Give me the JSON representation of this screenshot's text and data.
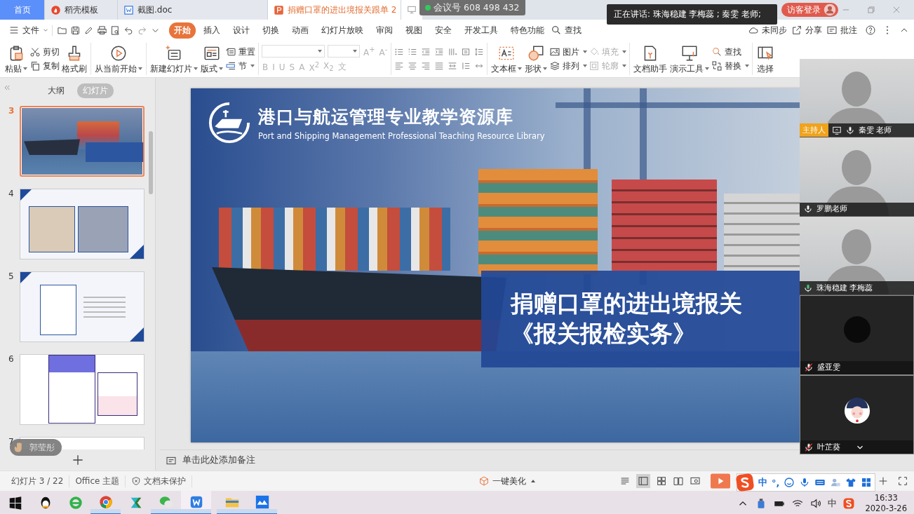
{
  "tabs": [
    {
      "label": "首页",
      "kind": "home",
      "selected": false
    },
    {
      "label": "稻壳模板",
      "kind": "template",
      "selected": false
    },
    {
      "label": "截图.doc",
      "kind": "doc",
      "selected": false
    },
    {
      "label": "捐赠口罩的进出境报关跟单 2",
      "kind": "ppt",
      "selected": true
    }
  ],
  "meeting_id": "会议号 608 498 432",
  "speaking": "正在讲话: 珠海稳建 李梅蕊 ; 秦雯 老师;",
  "guest_login": "访客登录",
  "menu": {
    "file": "文件",
    "tabs": [
      {
        "label": "开始",
        "selected": true
      },
      {
        "label": "插入",
        "selected": false
      },
      {
        "label": "设计",
        "selected": false
      },
      {
        "label": "切换",
        "selected": false
      },
      {
        "label": "动画",
        "selected": false
      },
      {
        "label": "幻灯片放映",
        "selected": false
      },
      {
        "label": "审阅",
        "selected": false
      },
      {
        "label": "视图",
        "selected": false
      },
      {
        "label": "安全",
        "selected": false
      },
      {
        "label": "开发工具",
        "selected": false
      },
      {
        "label": "特色功能",
        "selected": false
      }
    ],
    "search": "查找",
    "actions": [
      "未同步",
      "分享",
      "批注"
    ]
  },
  "ribbon": [
    {
      "items": [
        {
          "kind": "large",
          "label": "粘贴",
          "dropdown": true
        },
        {
          "kind": "pair",
          "items": [
            {
              "label": "剪切",
              "dropdown": false,
              "disabled": false
            },
            {
              "label": "复制",
              "dropdown": false,
              "disabled": false
            }
          ]
        },
        {
          "kind": "large",
          "label": "格式刷",
          "dropdown": false
        }
      ]
    },
    {
      "items": [
        {
          "kind": "large",
          "label": "从当前开始",
          "dropdown": true
        }
      ]
    },
    {
      "items": [
        {
          "kind": "large",
          "label": "新建幻灯片",
          "dropdown": true
        },
        {
          "kind": "large",
          "label": "版式",
          "dropdown": true
        },
        {
          "kind": "pair",
          "items": [
            {
              "label": "重置",
              "dropdown": false,
              "disabled": false
            },
            {
              "label": "节",
              "dropdown": true,
              "disabled": false
            }
          ]
        }
      ]
    },
    {
      "items": [
        {
          "kind": "font",
          "disabled": true,
          "size_glyphs": [
            "A$^{+}$",
            "A$^{-}$"
          ],
          "glyphs": [
            "B",
            "I",
            "U",
            "S",
            "A",
            "X$^{2}$",
            "X$_{2}$",
            "文"
          ]
        }
      ]
    },
    {
      "items": [
        {
          "kind": "paragraph"
        }
      ]
    },
    {
      "items": [
        {
          "kind": "large",
          "label": "文本框",
          "dropdown": true
        },
        {
          "kind": "large",
          "label": "形状",
          "dropdown": true
        },
        {
          "kind": "pair",
          "items": [
            {
              "label": "图片",
              "dropdown": true,
              "disabled": false
            },
            {
              "label": "排列",
              "dropdown": true,
              "disabled": false
            }
          ]
        },
        {
          "kind": "pair",
          "items": [
            {
              "label": "填充",
              "dropdown": true,
              "disabled": true
            },
            {
              "label": "轮廓",
              "dropdown": true,
              "disabled": true
            }
          ]
        }
      ]
    },
    {
      "items": [
        {
          "kind": "large",
          "label": "文档助手",
          "dropdown": false
        },
        {
          "kind": "large",
          "label": "演示工具",
          "dropdown": true
        },
        {
          "kind": "pair",
          "items": [
            {
              "label": "查找",
              "dropdown": false,
              "disabled": false
            },
            {
              "label": "替换",
              "dropdown": true,
              "disabled": false
            }
          ]
        }
      ]
    },
    {
      "items": [
        {
          "kind": "large",
          "label": "选择",
          "dropdown": false
        }
      ]
    }
  ],
  "panel_tabs": [
    {
      "label": "大纲",
      "selected": false
    },
    {
      "label": "幻灯片",
      "selected": true
    }
  ],
  "thumbnails": [
    {
      "number": "3",
      "kind": "photo",
      "selected": true
    },
    {
      "number": "4",
      "kind": "comic",
      "selected": false
    },
    {
      "number": "5",
      "kind": "letter",
      "selected": false
    },
    {
      "number": "6",
      "kind": "infographic",
      "selected": false
    },
    {
      "number": "7",
      "kind": "blank",
      "selected": false
    }
  ],
  "hand_raise": "郭莹彤",
  "slide": {
    "header_title": "港口与航运管理专业教学资源库",
    "header_subtitle": "Port and Shipping Management Professional Teaching Resource Library",
    "title_lines": [
      "捐赠口罩的进出境报关",
      "《报关报检实务》"
    ]
  },
  "notes_placeholder": "单击此处添加备注",
  "host_label": "主持人",
  "participants": [
    {
      "name": "秦雯 老师",
      "kind": "camera",
      "host": true,
      "sharing": true,
      "muted": false,
      "speaking": false
    },
    {
      "name": "罗鹏老师",
      "kind": "camera",
      "host": false,
      "sharing": false,
      "muted": false,
      "speaking": false
    },
    {
      "name": "珠海稳建 李梅蕊",
      "kind": "camera",
      "host": false,
      "sharing": false,
      "muted": false,
      "speaking": true
    },
    {
      "name": "盛亚雯",
      "kind": "no_video",
      "host": false,
      "sharing": false,
      "muted": true,
      "speaking": false
    },
    {
      "name": "叶芷葵",
      "kind": "avatar",
      "host": false,
      "sharing": false,
      "muted": true,
      "speaking": false
    }
  ],
  "status": {
    "slide_counter": "幻灯片 3 / 22",
    "theme": "Office 主题",
    "protection": "文档未保护",
    "beautify": "一键美化"
  },
  "ime_bar": [
    "中",
    "°,"
  ],
  "taskbar": [
    {
      "running": false,
      "selected": false
    },
    {
      "running": false,
      "selected": false
    },
    {
      "running": false,
      "selected": false
    },
    {
      "running": true,
      "selected": false
    },
    {
      "running": false,
      "selected": false
    },
    {
      "running": true,
      "selected": false
    },
    {
      "running": true,
      "selected": true
    },
    {
      "running": true,
      "selected": false
    },
    {
      "running": true,
      "selected": false
    }
  ],
  "tray": {
    "ime": "中",
    "time": "16:33",
    "date": "2020-3-26"
  }
}
